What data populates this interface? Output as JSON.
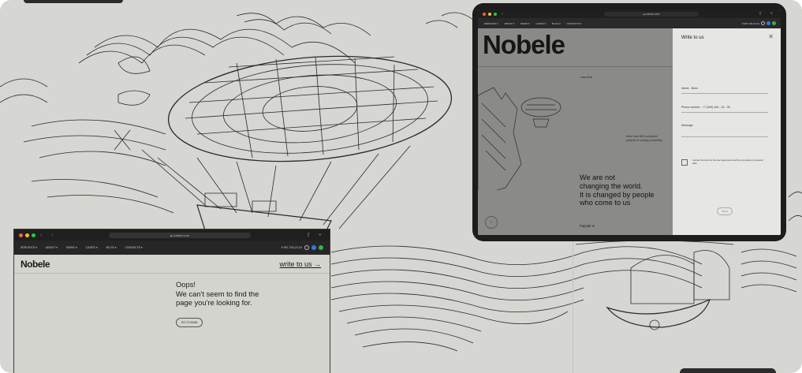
{
  "colors": {
    "background": "#d6d6d2",
    "dark_chrome": "#1f1f1f",
    "traffic": [
      "#ff5f57",
      "#febc2e",
      "#28c840"
    ],
    "badge_blue": "#2f7de0",
    "badge_green": "#38b54a"
  },
  "laptop": {
    "url": "nobele.com",
    "nav": [
      "SERVICES ▾",
      "ABOUT ▾",
      "NEWS ▾",
      "CASES ▾",
      "BLOG ▾",
      "CONTACTS ▾"
    ],
    "phone": "8 987 234-23-24",
    "logo": "Nobele",
    "write_link": "write to us →",
    "oops_lines": [
      "Oops!",
      "We can't seem to find the",
      "page you're looking for."
    ],
    "home_button": "GO TO MAIN"
  },
  "tablet": {
    "url": "nobele.com",
    "nav": [
      "SERVICES ▾",
      "ABOUT ▾",
      "NEWS ▾",
      "CASES ▾",
      "BLOG ▾",
      "CONTACTS ▾"
    ],
    "phone": "8 987 234-23-24",
    "logo": "Nobele",
    "law_firm": "Law firm",
    "small_text": "More than 850 completed projects of varying complexity",
    "big_lines": [
      "We are not",
      "changing the world.",
      "It is changed by people",
      "who come to us"
    ],
    "popular": "Popular ⊕",
    "form_title": "Write to us",
    "close": "✕",
    "name_field": "Name - Boris",
    "phone_field": "Phone number - +7 (349) 434 - 24 - 35",
    "message_field": "Message",
    "agree_text": "I accept the terms of the user agreement and the processing of personal data",
    "send_button": "Send"
  }
}
